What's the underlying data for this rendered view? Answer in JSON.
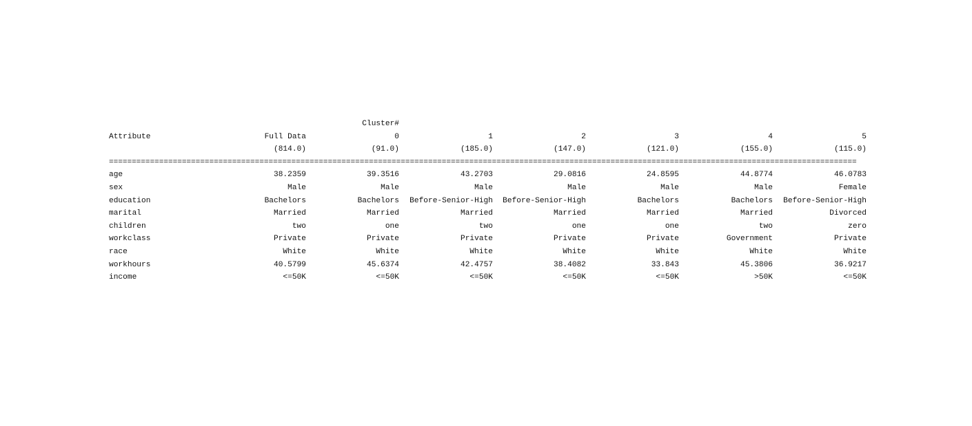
{
  "header": {
    "cluster_label": "Cluster#",
    "attribute_label": "Attribute",
    "columns": [
      "Full Data",
      "0",
      "1",
      "2",
      "3",
      "4",
      "5"
    ],
    "counts": [
      "(814.0)",
      "(91.0)",
      "(185.0)",
      "(147.0)",
      "(121.0)",
      "(155.0)",
      "(115.0)"
    ]
  },
  "separator": "====================================================================================================================================================================",
  "rows": [
    {
      "name": "age",
      "values": [
        "38.2359",
        "39.3516",
        "43.2703",
        "29.0816",
        "24.8595",
        "44.8774",
        "46.0783"
      ]
    },
    {
      "name": "sex",
      "values": [
        "Male",
        "Male",
        "Male",
        "Male",
        "Male",
        "Male",
        "Female"
      ]
    },
    {
      "name": "education",
      "values": [
        "Bachelors",
        "Bachelors",
        "Before-Senior-High",
        "Before-Senior-High",
        "Bachelors",
        "Bachelors",
        "Before-Senior-High"
      ]
    },
    {
      "name": "marital",
      "values": [
        "Married",
        "Married",
        "Married",
        "Married",
        "Married",
        "Married",
        "Divorced"
      ]
    },
    {
      "name": "children",
      "values": [
        "two",
        "one",
        "two",
        "one",
        "one",
        "two",
        "zero"
      ]
    },
    {
      "name": "workclass",
      "values": [
        "Private",
        "Private",
        "Private",
        "Private",
        "Private",
        "Government",
        "Private"
      ]
    },
    {
      "name": "race",
      "values": [
        "White",
        "White",
        "White",
        "White",
        "White",
        "White",
        "White"
      ]
    },
    {
      "name": "workhours",
      "values": [
        "40.5799",
        "45.6374",
        "42.4757",
        "38.4082",
        "33.843",
        "45.3806",
        "36.9217"
      ]
    },
    {
      "name": "income",
      "values": [
        "<=50K",
        "<=50K",
        "<=50K",
        "<=50K",
        "<=50K",
        ">50K",
        "<=50K"
      ]
    }
  ]
}
